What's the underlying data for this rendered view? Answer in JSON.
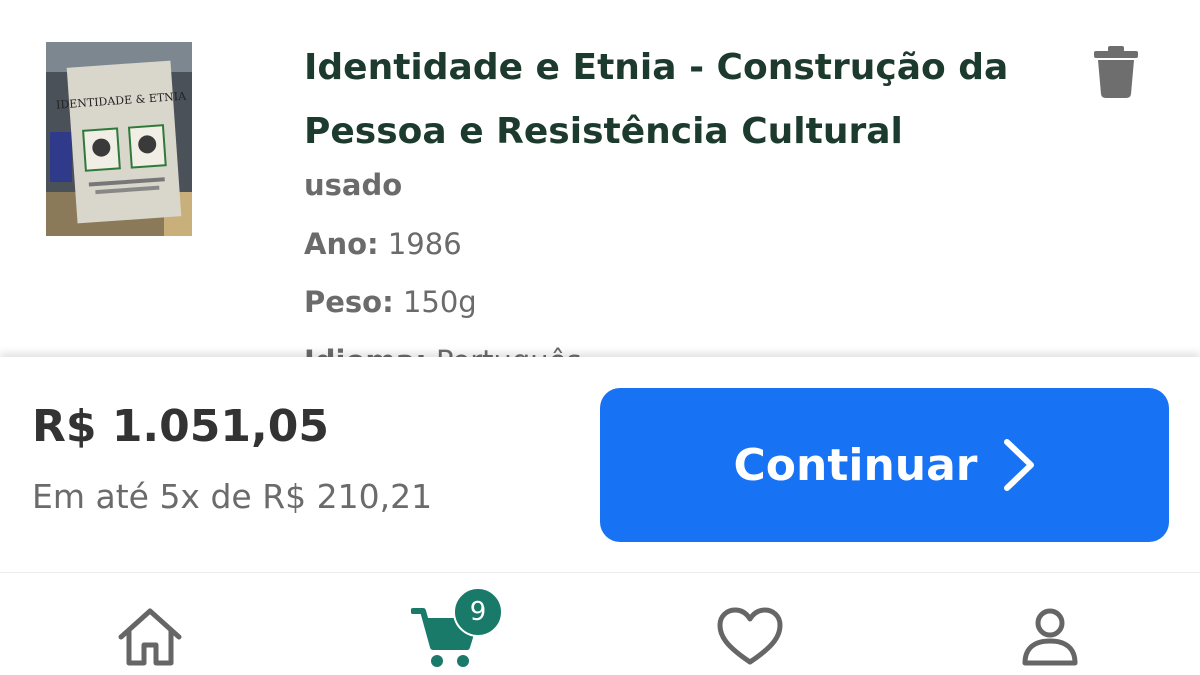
{
  "product": {
    "title": "Identidade e Etnia - Construção da Pessoa e Resistência Cultural",
    "condition": "usado",
    "year_label": "Ano:",
    "year": "1986",
    "weight_label": "Peso:",
    "weight": "150g",
    "language_label": "Idioma:",
    "language": "Português",
    "cover_title": "IDENTIDADE & ETNIA"
  },
  "summary": {
    "total": "R$ 1.051,05",
    "installments": "Em até 5x de R$ 210,21"
  },
  "actions": {
    "continue_label": "Continuar"
  },
  "nav": {
    "items": [
      {
        "icon": "home-icon"
      },
      {
        "icon": "cart-icon",
        "badge": "9"
      },
      {
        "icon": "heart-icon"
      },
      {
        "icon": "profile-icon"
      }
    ]
  },
  "colors": {
    "primary_button": "#1872f4",
    "title_text": "#1d3a2f",
    "badge": "#1a7a6a",
    "cart_active": "#1a7a6a",
    "muted_text": "#6b6b6b"
  }
}
